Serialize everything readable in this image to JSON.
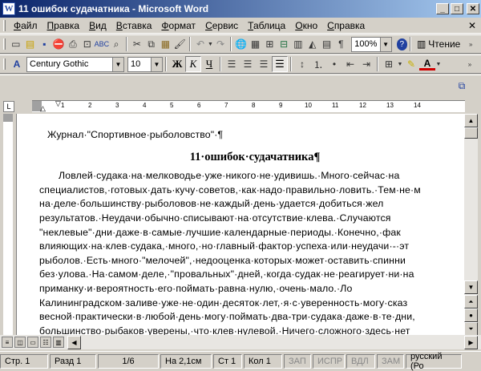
{
  "window": {
    "title": "11 ошибок судачатника - Microsoft Word",
    "app_letter": "W"
  },
  "menu": [
    "Файл",
    "Правка",
    "Вид",
    "Вставка",
    "Формат",
    "Сервис",
    "Таблица",
    "Окно",
    "Справка"
  ],
  "standard_toolbar": {
    "zoom": "100%",
    "reading_label": "Чтение"
  },
  "format_toolbar": {
    "font": "Century Gothic",
    "size": "10",
    "bold": "Ж",
    "italic": "К",
    "underline": "Ч",
    "font_color_letter": "A"
  },
  "document": {
    "header": "Журнал·\"Спортивное·рыболовство\"·¶",
    "title": "11·ошибок·судачатника¶",
    "lines": [
      "Ловлей·судака·на·мелководье·уже·никого·не·удивишь.·Много·сейчас·на",
      "специалистов,·готовых·дать·кучу·советов,·как·надо·правильно·ловить.·Тем·не·м",
      "на·деле·большинству·рыболовов·не·каждый·день·удается·добиться·жел",
      "результатов.·Неудачи·обычно·списывают·на·отсутствие·клева.·Случаются",
      "\"неклевые\"·дни·даже·в·самые·лучшие·календарные·периоды.·Конечно,·фак",
      "влияющих·на·клев·судака,·много,·но·главный·фактор·успеха·или·неудачи·-·эт",
      "рыболов.·Есть·много·\"мелочей\",·недооценка·которых·может·оставить·спинни",
      "без·улова.·На·самом·деле,·\"провальных\"·дней,·когда·судак·не·реагирует·ни·на",
      "приманку·и·вероятность·его·поймать·равна·нулю,·очень·мало.·Ло",
      "Калининградском·заливе·уже·не·один·десяток·лет,·я·с·уверенность·могу·сказ",
      "весной·практически·в·любой·день·могу·поймать·два-три·судака·даже·в·те·дни,",
      "большинство·рыбаков·уверены,·что·клев·нулевой.·Ничего·сложного·здесь·нет"
    ]
  },
  "ruler": {
    "corner": "L",
    "ticks": [
      "1",
      "2",
      "3",
      "4",
      "5",
      "6",
      "7",
      "8",
      "9",
      "10",
      "11",
      "12",
      "13",
      "14"
    ]
  },
  "status": {
    "page": "Стр. 1",
    "section": "Разд 1",
    "pages": "1/6",
    "at": "На 2,1см",
    "line": "Ст 1",
    "col": "Кол 1",
    "rec": "ЗАП",
    "trk": "ИСПР",
    "ext": "ВДЛ",
    "ovr": "ЗАМ",
    "lang": "русский (Ро"
  },
  "icons": {
    "menu_help_icon": "?",
    "new": "▭",
    "open": "▤",
    "save": "▪",
    "print": "⎙",
    "preview": "⊡",
    "spell": "ᴬᴮᶜ",
    "cut": "✂",
    "copy": "⧉",
    "paste": "▦",
    "undo": "↶",
    "help": "?",
    "styles": "A̲"
  }
}
